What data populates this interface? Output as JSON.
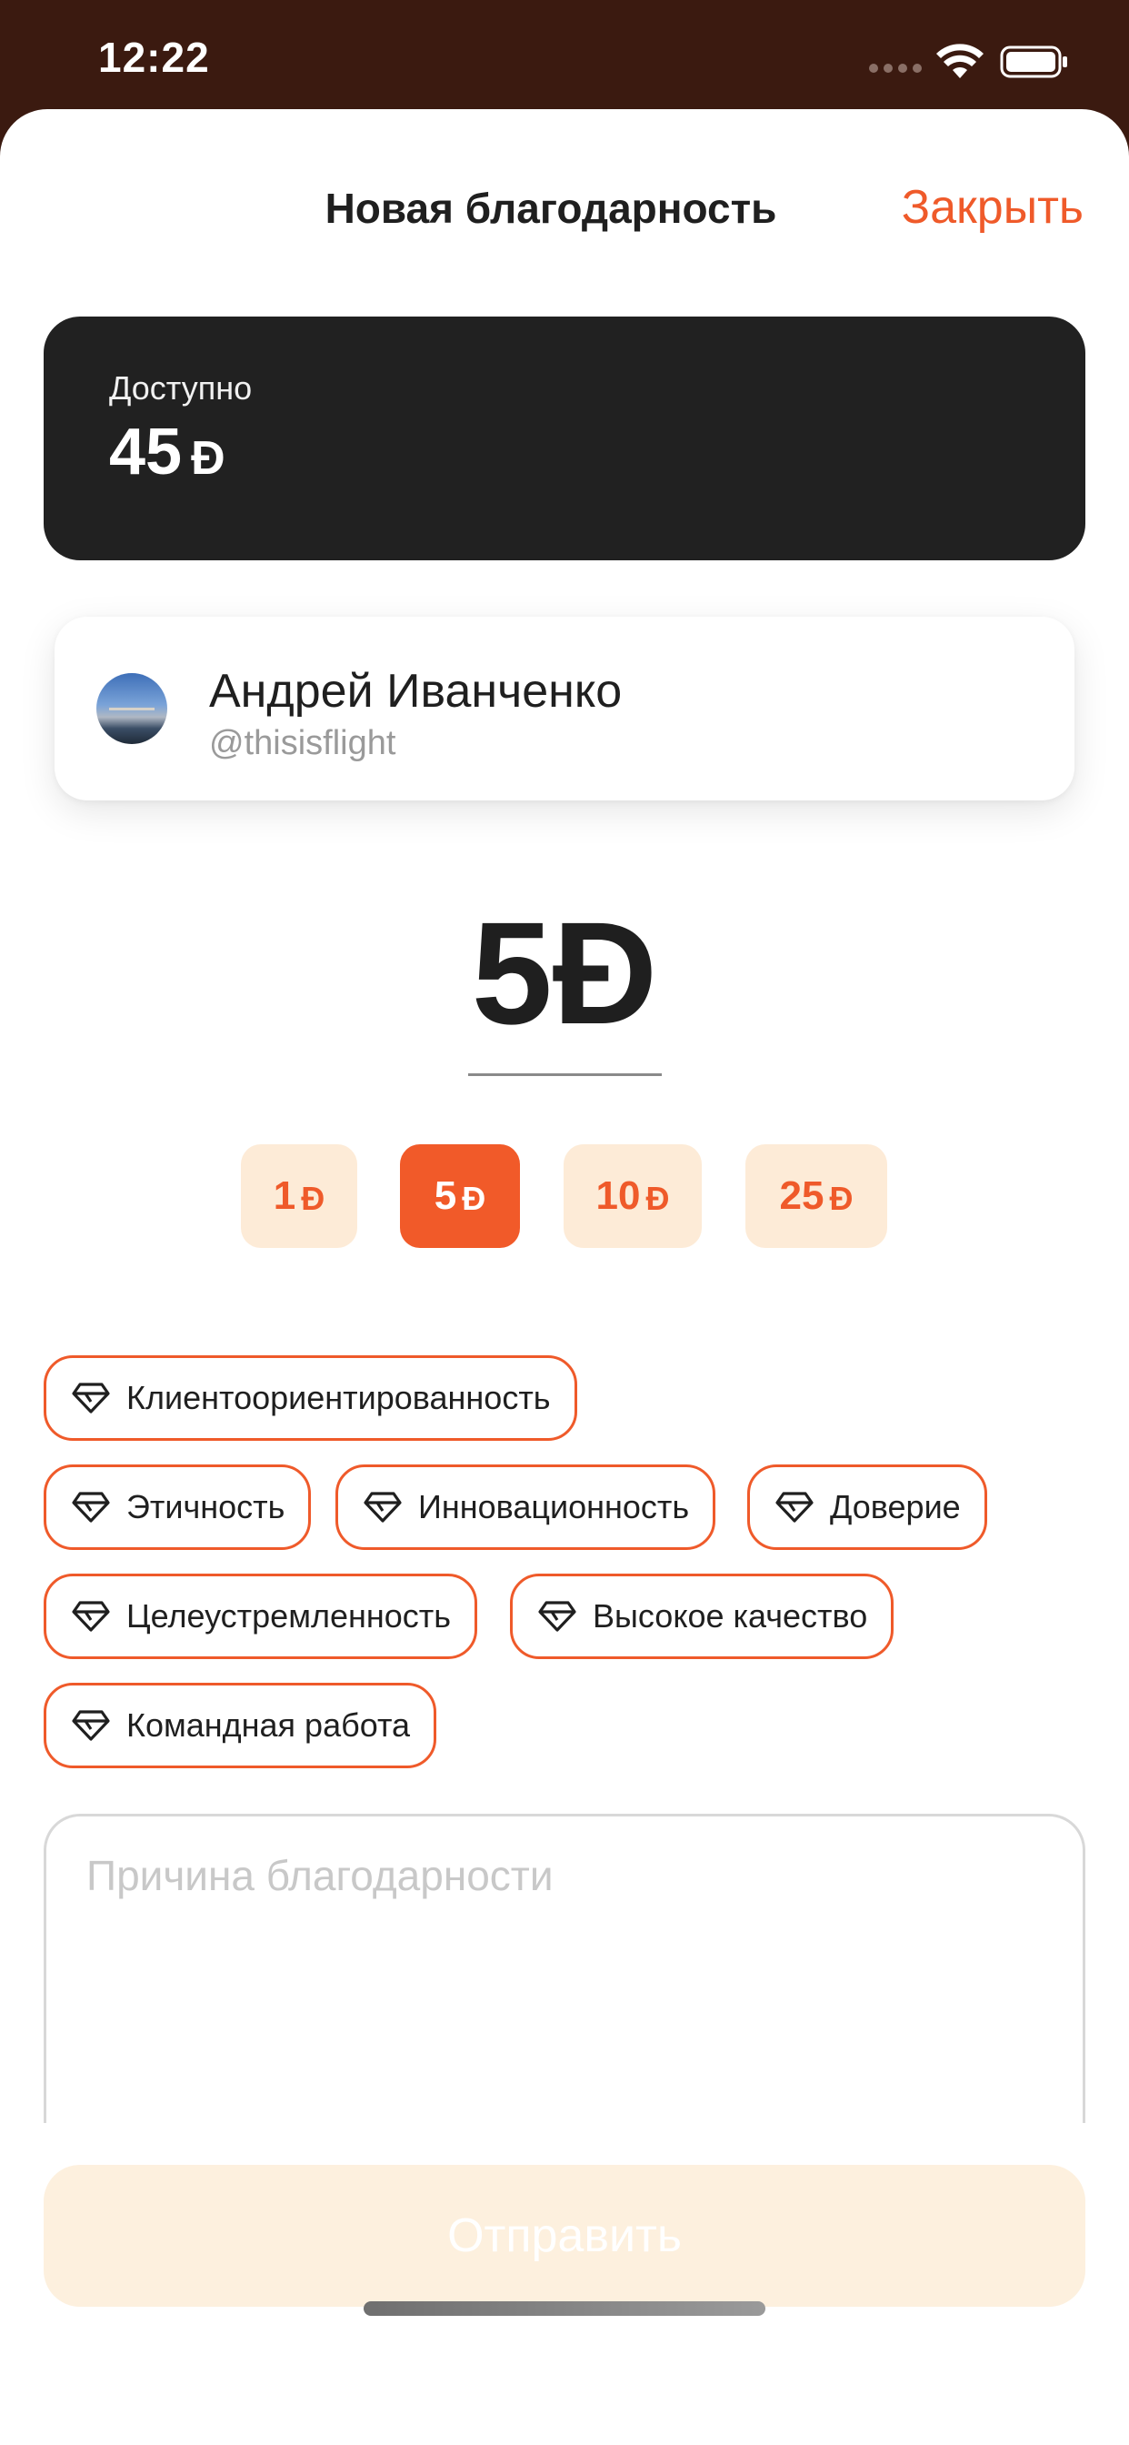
{
  "status_bar": {
    "time": "12:22"
  },
  "header": {
    "title": "Новая благодарность",
    "close_label": "Закрыть"
  },
  "balance": {
    "label": "Доступно",
    "amount": "45",
    "currency_symbol": "Đ"
  },
  "recipient": {
    "name": "Андрей Иванченко",
    "handle": "@thisisflight"
  },
  "amount": {
    "value": "5",
    "currency_symbol": "Đ"
  },
  "amount_options": [
    {
      "label": "1",
      "currency": "Đ",
      "selected": false
    },
    {
      "label": "5",
      "currency": "Đ",
      "selected": true
    },
    {
      "label": "10",
      "currency": "Đ",
      "selected": false
    },
    {
      "label": "25",
      "currency": "Đ",
      "selected": false
    }
  ],
  "values": [
    {
      "label": "Клиентоориентированность",
      "icon": "diamond-icon"
    },
    {
      "label": "Этичность",
      "icon": "diamond-icon"
    },
    {
      "label": "Инновационность",
      "icon": "diamond-icon"
    },
    {
      "label": "Доверие",
      "icon": "diamond-icon"
    },
    {
      "label": "Целеустремленность",
      "icon": "diamond-icon"
    },
    {
      "label": "Высокое качество",
      "icon": "diamond-icon"
    },
    {
      "label": "Командная работа",
      "icon": "diamond-icon"
    }
  ],
  "reason": {
    "placeholder": "Причина благодарности",
    "value": ""
  },
  "send_label": "Отправить",
  "colors": {
    "accent": "#ef5a2a",
    "chip_bg": "#fdebd7",
    "card_dark": "#212121",
    "status_bar_bg": "#3b1a10"
  }
}
